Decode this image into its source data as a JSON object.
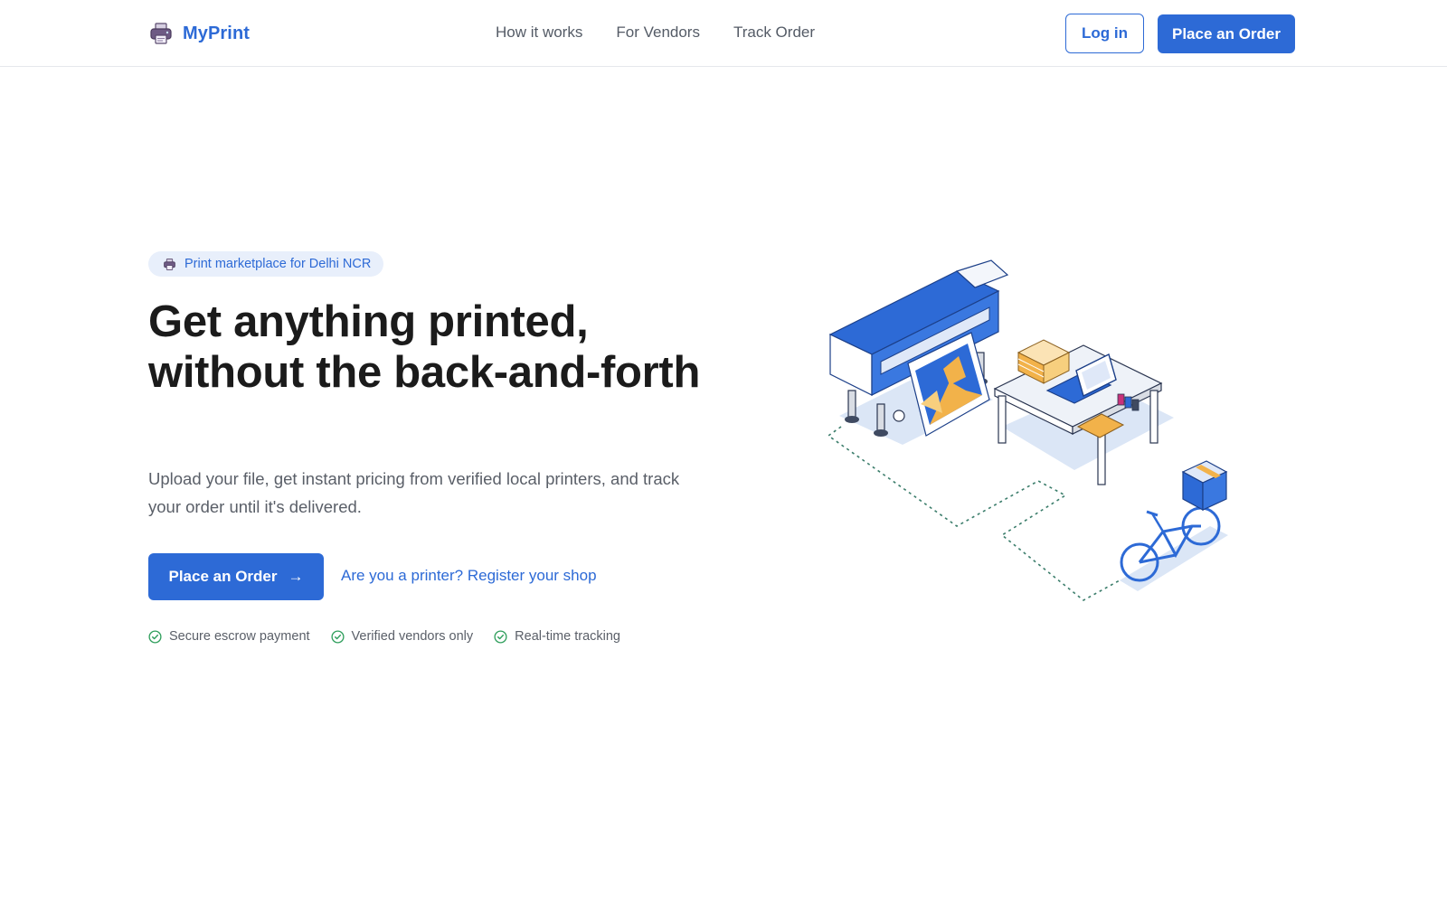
{
  "brand": {
    "name": "MyPrint",
    "icon": "printer-icon"
  },
  "nav": {
    "items": [
      {
        "label": "How it works"
      },
      {
        "label": "For Vendors"
      },
      {
        "label": "Track Order"
      }
    ]
  },
  "header_actions": {
    "login_label": "Log in",
    "order_label": "Place an Order"
  },
  "hero": {
    "badge": {
      "icon": "printer-icon",
      "text": "Print marketplace for Delhi NCR"
    },
    "headline": "Get anything printed, without the back-and-forth",
    "subtext": "Upload your file, get instant pricing from verified local printers, and track your order until it's delivered.",
    "primary_cta": {
      "label": "Place an Order",
      "arrow": "→"
    },
    "secondary_link": "Are you a printer? Register your shop",
    "features": [
      {
        "icon": "check-circle-icon",
        "text": "Secure escrow payment"
      },
      {
        "icon": "check-circle-icon",
        "text": "Verified vendors only"
      },
      {
        "icon": "check-circle-icon",
        "text": "Real-time tracking"
      }
    ]
  },
  "colors": {
    "accent": "#2d6ad6",
    "badge_bg": "#e8effb",
    "check": "#2e9e5b",
    "heading": "#1b1b1b",
    "muted": "#5a5f68"
  }
}
